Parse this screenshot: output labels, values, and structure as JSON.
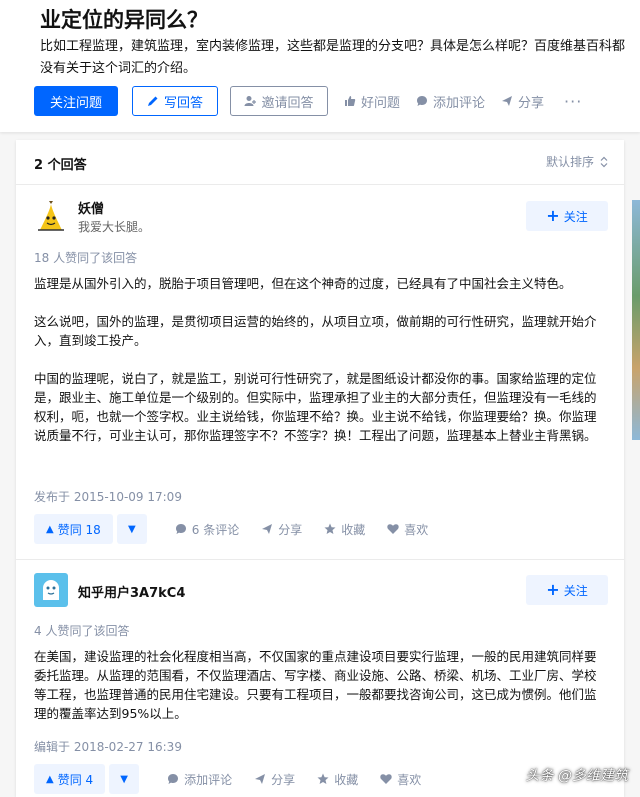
{
  "question": {
    "title": "业定位的异同么？",
    "description": "比如工程监理，建筑监理，室内装修监理，这些都是监理的分支吧？具体是怎么样呢？百度维基百科都没有关于这个词汇的介绍。",
    "actions": {
      "follow": "关注问题",
      "write": "写回答",
      "invite": "邀请回答",
      "good": "好问题",
      "comment": "添加评论",
      "share": "分享",
      "more": "···"
    }
  },
  "answers_header": {
    "count": "2 个回答",
    "sort": "默认排序"
  },
  "answers": [
    {
      "author": "妖僧",
      "bio": "我爱大长腿。",
      "follow": "关注",
      "votes_text": "18 人赞同了该回答",
      "paragraphs": [
        "监理是从国外引入的，脱胎于项目管理吧，但在这个神奇的过度，已经具有了中国社会主义特色。",
        "这么说吧，国外的监理，是贯彻项目运营的始终的，从项目立项，做前期的可行性研究，监理就开始介入，直到竣工投产。",
        "中国的监理呢，说白了，就是监工，别说可行性研究了，就是图纸设计都没你的事。国家给监理的定位是，跟业主、施工单位是一个级别的。但实际中，监理承担了业主的大部分责任，但监理没有一毛线的权利，呃，也就一个签字权。业主说给钱，你监理不给？换。业主说不给钱，你监理要给？换。你监理说质量不行，可业主认可，那你监理签字不？不签字？换！工程出了问题，监理基本上替业主背黑锅。"
      ],
      "date": "发布于 2015-10-09 17:09",
      "vote_label": "赞同 18",
      "comments": "6 条评论",
      "share": "分享",
      "collect": "收藏",
      "like": "喜欢"
    },
    {
      "author": "知乎用户3A7kC4",
      "follow": "关注",
      "votes_text": "4 人赞同了该回答",
      "paragraphs": [
        "在美国，建设监理的社会化程度相当高，不仅国家的重点建设项目要实行监理，一般的民用建筑同样要委托监理。从监理的范围看，不仅监理酒店、写字楼、商业设施、公路、桥梁、机场、工业厂房、学校等工程，也监理普通的民用住宅建设。只要有工程项目，一般都要找咨询公司，这已成为惯例。他们监理的覆盖率达到95%以上。"
      ],
      "date": "编辑于 2018-02-27 16:39",
      "vote_label": "赞同 4",
      "comments": "添加评论",
      "share": "分享",
      "collect": "收藏",
      "like": "喜欢"
    }
  ],
  "watermark": "头条 @多维建筑",
  "colors": {
    "primary": "#0066ff",
    "primary_light": "#eef4ff",
    "meta_grey": "#8590a6"
  }
}
